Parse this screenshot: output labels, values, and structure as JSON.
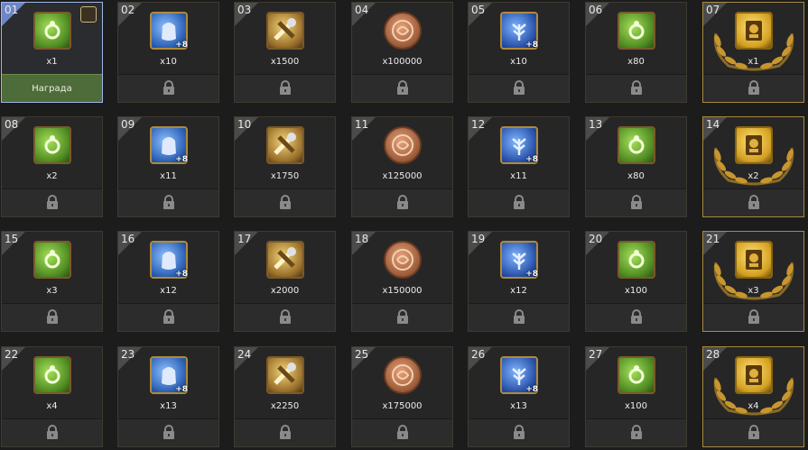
{
  "cells": [
    {
      "num": "01",
      "qty": "x1",
      "icon": "green-scroll-icon",
      "claim": "Награда",
      "state": "active"
    },
    {
      "num": "02",
      "qty": "x10",
      "icon": "blue-pouch-icon",
      "badge": "+8"
    },
    {
      "num": "03",
      "qty": "x1500",
      "icon": "tools-icon"
    },
    {
      "num": "04",
      "qty": "x100000",
      "icon": "cookie-icon"
    },
    {
      "num": "05",
      "qty": "x10",
      "icon": "blue-herb-icon",
      "badge": "+8"
    },
    {
      "num": "06",
      "qty": "x80",
      "icon": "green-scroll-icon"
    },
    {
      "num": "07",
      "qty": "x1",
      "icon": "golden-relic-icon",
      "state": "special"
    },
    {
      "num": "08",
      "qty": "x2",
      "icon": "green-scroll-icon"
    },
    {
      "num": "09",
      "qty": "x11",
      "icon": "blue-pouch-icon",
      "badge": "+8"
    },
    {
      "num": "10",
      "qty": "x1750",
      "icon": "tools-icon"
    },
    {
      "num": "11",
      "qty": "x125000",
      "icon": "cookie-icon"
    },
    {
      "num": "12",
      "qty": "x11",
      "icon": "blue-herb-icon",
      "badge": "+8"
    },
    {
      "num": "13",
      "qty": "x80",
      "icon": "green-scroll-icon"
    },
    {
      "num": "14",
      "qty": "x2",
      "icon": "golden-relic-icon",
      "state": "special"
    },
    {
      "num": "15",
      "qty": "x3",
      "icon": "green-scroll-icon"
    },
    {
      "num": "16",
      "qty": "x12",
      "icon": "blue-pouch-icon",
      "badge": "+8"
    },
    {
      "num": "17",
      "qty": "x2000",
      "icon": "tools-icon"
    },
    {
      "num": "18",
      "qty": "x150000",
      "icon": "cookie-icon"
    },
    {
      "num": "19",
      "qty": "x12",
      "icon": "blue-herb-icon",
      "badge": "+8"
    },
    {
      "num": "20",
      "qty": "x100",
      "icon": "green-scroll-icon"
    },
    {
      "num": "21",
      "qty": "x3",
      "icon": "golden-relic-icon",
      "state": "special"
    },
    {
      "num": "22",
      "qty": "x4",
      "icon": "green-scroll-icon"
    },
    {
      "num": "23",
      "qty": "x13",
      "icon": "blue-pouch-icon",
      "badge": "+8"
    },
    {
      "num": "24",
      "qty": "x2250",
      "icon": "tools-icon"
    },
    {
      "num": "25",
      "qty": "x175000",
      "icon": "cookie-icon"
    },
    {
      "num": "26",
      "qty": "x13",
      "icon": "blue-herb-icon",
      "badge": "+8"
    },
    {
      "num": "27",
      "qty": "x100",
      "icon": "green-scroll-icon"
    },
    {
      "num": "28",
      "qty": "x4",
      "icon": "golden-relic-icon",
      "state": "special"
    }
  ]
}
